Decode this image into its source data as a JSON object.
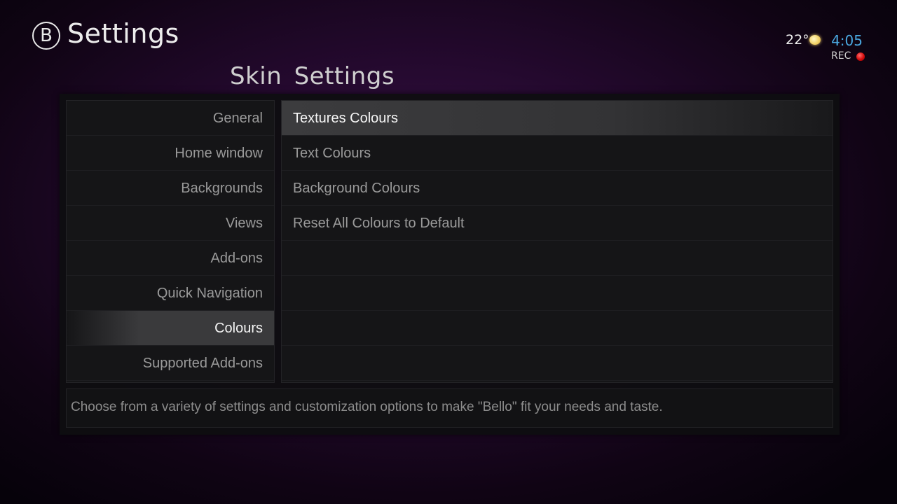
{
  "header": {
    "logo_letter": "B",
    "title": "Settings",
    "section_title": "Skin  Settings"
  },
  "status": {
    "temperature": "22°",
    "weather_icon": "sun-icon",
    "time": "4:05",
    "rec_label": "REC",
    "rec_color": "#d40c0c",
    "time_color": "#4aa8e0"
  },
  "categories": [
    {
      "label": "General"
    },
    {
      "label": "Home window"
    },
    {
      "label": "Backgrounds"
    },
    {
      "label": "Views"
    },
    {
      "label": "Add-ons"
    },
    {
      "label": "Quick Navigation"
    },
    {
      "label": "Colours",
      "selected": true
    },
    {
      "label": "Supported Add-ons"
    }
  ],
  "options": [
    {
      "label": "Textures Colours",
      "focused": true
    },
    {
      "label": "Text Colours"
    },
    {
      "label": "Background Colours"
    },
    {
      "label": "Reset All Colours to Default"
    }
  ],
  "description": "Choose from a variety of settings and customization options to make \"Bello\" fit your needs and taste."
}
